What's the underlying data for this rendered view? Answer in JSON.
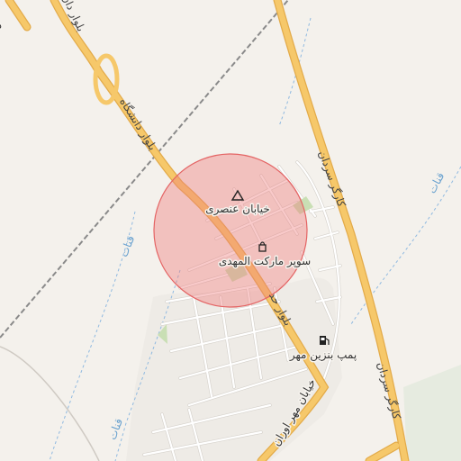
{
  "map": {
    "labels": {
      "street_enseri": "خیابان عنصری",
      "supermarket": "سوپر مارکت المهدی",
      "fuel_station": "پمپ بنزین مهر",
      "street_mehr_avaran": "خیابان مهر اوران",
      "blvd_daneshgah": "بلوار دانشگاه",
      "blvd_top": "بلوار دان",
      "blvd_south": "بلوار حد",
      "kargar_north": "کارگر سردان",
      "kargar_south": "کارگر سردان",
      "qanat_1": "قنات",
      "qanat_2": "قنات",
      "qanat_3": "قنات",
      "corner_fragment": "دا"
    },
    "icons": {
      "peak": "triangle-peak-icon",
      "supermarket": "shopping-bag-icon",
      "fuel": "fuel-pump-icon"
    },
    "colors": {
      "background": "#f4f1ec",
      "major_road": "#f6c86a",
      "major_road_casing": "#e3ab4a",
      "minor_road": "#ffffff",
      "minor_road_casing": "#d6d2cc",
      "highlight_circle": "#f07a7a",
      "water": "#8fb9e0",
      "park": "#c9dfb4",
      "railway": "#8a8a8a"
    }
  }
}
